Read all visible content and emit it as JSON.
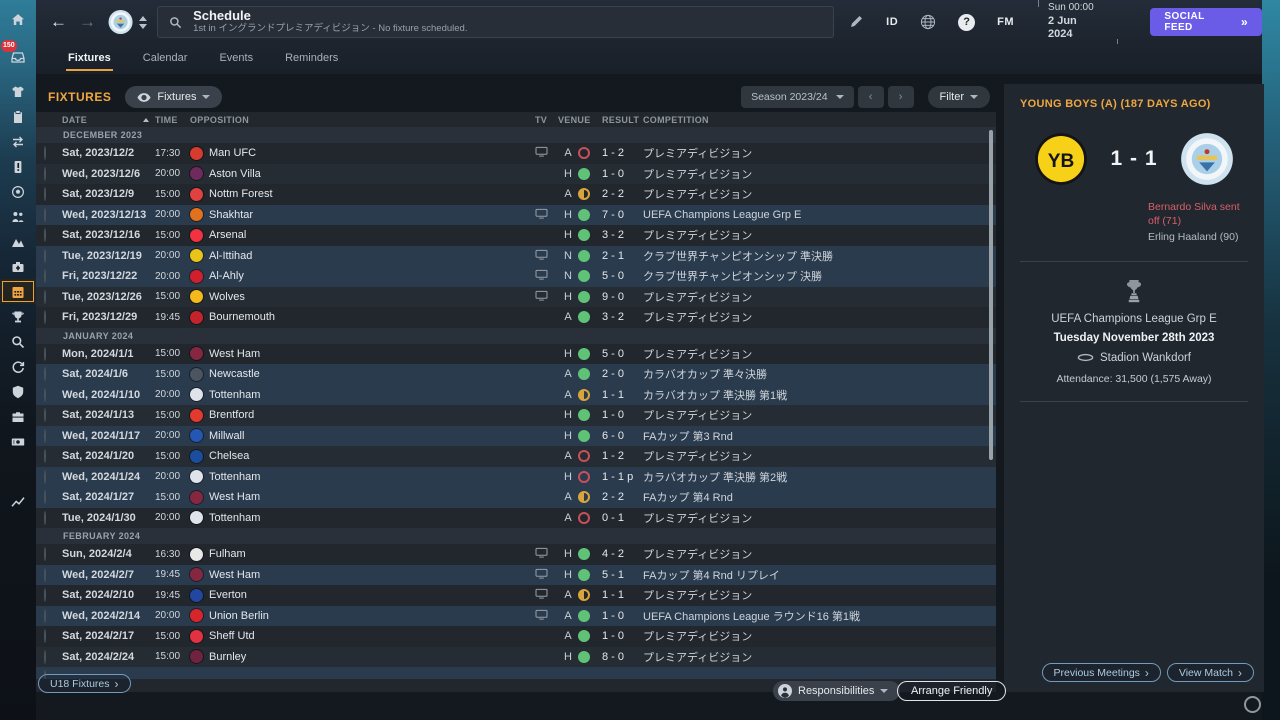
{
  "app": {
    "title": "Schedule",
    "subtitle": "1st in イングランドプレミアディビジョン - No fixture scheduled.",
    "id_label": "ID",
    "fm_label": "FM",
    "clock_time": "Sun 00:00",
    "clock_date": "2 Jun 2024",
    "social_feed": {
      "label": "SOCIAL FEED",
      "arrow": "»"
    }
  },
  "tabs": [
    {
      "label": "Fixtures",
      "active": true
    },
    {
      "label": "Calendar",
      "active": false
    },
    {
      "label": "Events",
      "active": false
    },
    {
      "label": "Reminders",
      "active": false
    }
  ],
  "sidebar": {
    "inbox_badge": "150",
    "items": [
      {
        "icon": "home"
      },
      {
        "icon": "inbox",
        "badge": "150"
      },
      {
        "icon": "shirt"
      },
      {
        "icon": "clipboard"
      },
      {
        "icon": "swap"
      },
      {
        "icon": "card"
      },
      {
        "icon": "ball"
      },
      {
        "icon": "staff"
      },
      {
        "icon": "mountain"
      },
      {
        "icon": "medical"
      },
      {
        "icon": "calendar",
        "active": true
      },
      {
        "icon": "trophy"
      },
      {
        "icon": "search"
      },
      {
        "icon": "refresh"
      },
      {
        "icon": "shield"
      },
      {
        "icon": "briefcase"
      },
      {
        "icon": "money"
      },
      {
        "icon": "chart"
      }
    ]
  },
  "fixtures_panel": {
    "heading": "FIXTURES",
    "view_dropdown": "Fixtures",
    "season_dropdown": "Season 2023/24",
    "prev_label": "‹",
    "next_label": "›",
    "filter_label": "Filter",
    "columns": [
      "DATE",
      "TIME",
      "OPPOSITION",
      "TV",
      "VENUE",
      "RESULT",
      "COMPETITION"
    ],
    "sections": [
      {
        "month": "DECEMBER 2023",
        "rows": [
          {
            "date": "Sat, 2023/12/2",
            "time": "17:30",
            "team": "Man UFC",
            "badge": "#d63b2f",
            "tv": true,
            "venue": "A",
            "result": "loss",
            "score": "1 - 2",
            "comp": "プレミアディビジョン",
            "hl": false
          },
          {
            "date": "Wed, 2023/12/6",
            "time": "20:00",
            "team": "Aston Villa",
            "badge": "#6e2a5a",
            "tv": false,
            "venue": "H",
            "result": "win",
            "score": "1 - 0",
            "comp": "プレミアディビジョン",
            "hl": false
          },
          {
            "date": "Sat, 2023/12/9",
            "time": "15:00",
            "team": "Nottm Forest",
            "badge": "#e0433f",
            "tv": false,
            "venue": "A",
            "result": "draw",
            "score": "2 - 2",
            "comp": "プレミアディビジョン",
            "hl": false
          },
          {
            "date": "Wed, 2023/12/13",
            "time": "20:00",
            "team": "Shakhtar",
            "badge": "#e2711d",
            "tv": true,
            "venue": "H",
            "result": "win",
            "score": "7 - 0",
            "comp": "UEFA Champions League Grp E",
            "hl": true
          },
          {
            "date": "Sat, 2023/12/16",
            "time": "15:00",
            "team": "Arsenal",
            "badge": "#ef3340",
            "tv": false,
            "venue": "H",
            "result": "win",
            "score": "3 - 2",
            "comp": "プレミアディビジョン",
            "hl": false
          },
          {
            "date": "Tue, 2023/12/19",
            "time": "20:00",
            "team": "Al-Ittihad",
            "badge": "#e8c419",
            "tv": true,
            "venue": "N",
            "result": "win",
            "score": "2 - 1",
            "comp": "クラブ世界チャンピオンシップ 準決勝",
            "hl": true
          },
          {
            "date": "Fri, 2023/12/22",
            "time": "20:00",
            "team": "Al-Ahly",
            "badge": "#d0202e",
            "tv": true,
            "venue": "N",
            "result": "win",
            "score": "5 - 0",
            "comp": "クラブ世界チャンピオンシップ 決勝",
            "hl": true
          },
          {
            "date": "Tue, 2023/12/26",
            "time": "15:00",
            "team": "Wolves",
            "badge": "#f6b91c",
            "tv": true,
            "venue": "H",
            "result": "win",
            "score": "9 - 0",
            "comp": "プレミアディビジョン",
            "hl": false
          },
          {
            "date": "Fri, 2023/12/29",
            "time": "19:45",
            "team": "Bournemouth",
            "badge": "#c3242c",
            "tv": false,
            "venue": "A",
            "result": "win",
            "score": "3 - 2",
            "comp": "プレミアディビジョン",
            "hl": false
          }
        ]
      },
      {
        "month": "JANUARY 2024",
        "rows": [
          {
            "date": "Mon, 2024/1/1",
            "time": "15:00",
            "team": "West Ham",
            "badge": "#862740",
            "tv": false,
            "venue": "H",
            "result": "win",
            "score": "5 - 0",
            "comp": "プレミアディビジョン",
            "hl": false
          },
          {
            "date": "Sat, 2024/1/6",
            "time": "15:00",
            "team": "Newcastle",
            "badge": "#4a5560",
            "tv": false,
            "venue": "A",
            "result": "win",
            "score": "2 - 0",
            "comp": "カラバオカップ 準々決勝",
            "hl": true
          },
          {
            "date": "Wed, 2024/1/10",
            "time": "20:00",
            "team": "Tottenham",
            "badge": "#dfe4ea",
            "tv": false,
            "venue": "A",
            "result": "draw",
            "score": "1 - 1",
            "comp": "カラバオカップ 準決勝 第1戦",
            "hl": true
          },
          {
            "date": "Sat, 2024/1/13",
            "time": "15:00",
            "team": "Brentford",
            "badge": "#e23a2e",
            "tv": false,
            "venue": "H",
            "result": "win",
            "score": "1 - 0",
            "comp": "プレミアディビジョン",
            "hl": false
          },
          {
            "date": "Wed, 2024/1/17",
            "time": "20:00",
            "team": "Millwall",
            "badge": "#2456b4",
            "tv": false,
            "venue": "H",
            "result": "win",
            "score": "6 - 0",
            "comp": "FAカップ 第3 Rnd",
            "hl": true
          },
          {
            "date": "Sat, 2024/1/20",
            "time": "15:00",
            "team": "Chelsea",
            "badge": "#1a4e9c",
            "tv": false,
            "venue": "A",
            "result": "loss",
            "score": "1 - 2",
            "comp": "プレミアディビジョン",
            "hl": false
          },
          {
            "date": "Wed, 2024/1/24",
            "time": "20:00",
            "team": "Tottenham",
            "badge": "#dfe4ea",
            "tv": false,
            "venue": "H",
            "result": "loss",
            "score": "1 - 1 p",
            "comp": "カラバオカップ 準決勝 第2戦",
            "hl": true
          },
          {
            "date": "Sat, 2024/1/27",
            "time": "15:00",
            "team": "West Ham",
            "badge": "#862740",
            "tv": false,
            "venue": "A",
            "result": "draw",
            "score": "2 - 2",
            "comp": "FAカップ 第4 Rnd",
            "hl": true
          },
          {
            "date": "Tue, 2024/1/30",
            "time": "20:00",
            "team": "Tottenham",
            "badge": "#dfe4ea",
            "tv": false,
            "venue": "A",
            "result": "loss",
            "score": "0 - 1",
            "comp": "プレミアディビジョン",
            "hl": false
          }
        ]
      },
      {
        "month": "FEBRUARY 2024",
        "rows": [
          {
            "date": "Sun, 2024/2/4",
            "time": "16:30",
            "team": "Fulham",
            "badge": "#e8e8e8",
            "tv": true,
            "venue": "H",
            "result": "win",
            "score": "4 - 2",
            "comp": "プレミアディビジョン",
            "hl": false
          },
          {
            "date": "Wed, 2024/2/7",
            "time": "19:45",
            "team": "West Ham",
            "badge": "#862740",
            "tv": true,
            "venue": "H",
            "result": "win",
            "score": "5 - 1",
            "comp": "FAカップ 第4 Rnd リプレイ",
            "hl": true
          },
          {
            "date": "Sat, 2024/2/10",
            "time": "19:45",
            "team": "Everton",
            "badge": "#2247a0",
            "tv": true,
            "venue": "A",
            "result": "draw",
            "score": "1 - 1",
            "comp": "プレミアディビジョン",
            "hl": false
          },
          {
            "date": "Wed, 2024/2/14",
            "time": "20:00",
            "team": "Union Berlin",
            "badge": "#d8252c",
            "tv": true,
            "venue": "A",
            "result": "win",
            "score": "1 - 0",
            "comp": "UEFA Champions League ラウンド16 第1戦",
            "hl": true
          },
          {
            "date": "Sat, 2024/2/17",
            "time": "15:00",
            "team": "Sheff Utd",
            "badge": "#e23241",
            "tv": false,
            "venue": "A",
            "result": "win",
            "score": "1 - 0",
            "comp": "プレミアディビジョン",
            "hl": false
          },
          {
            "date": "Sat, 2024/2/24",
            "time": "15:00",
            "team": "Burnley",
            "badge": "#70233f",
            "tv": false,
            "venue": "H",
            "result": "win",
            "score": "8 - 0",
            "comp": "プレミアディビジョン",
            "hl": false
          },
          {
            "date": "",
            "time": "",
            "team": "",
            "badge": "#3f9e4f",
            "tv": false,
            "venue": "",
            "result": "",
            "score": "",
            "comp": "",
            "hl": true,
            "partial": true
          }
        ]
      }
    ],
    "u18_button": "U18 Fixtures",
    "responsibilities_button": "Responsibilities",
    "arrange_friendly_button": "Arrange Friendly"
  },
  "match_panel": {
    "header": "YOUNG BOYS (A) (187 DAYS AGO)",
    "home_short": "YB",
    "score": "1 - 1",
    "events": [
      {
        "text": "Bernardo Silva sent off (71)",
        "type": "red"
      },
      {
        "text": "Erling Haaland (90)",
        "type": "normal"
      }
    ],
    "competition": "UEFA Champions League Grp E",
    "date": "Tuesday November 28th 2023",
    "stadium": "Stadion Wankdorf",
    "attendance": "Attendance: 31,500 (1,575 Away)",
    "prev_meetings_button": "Previous Meetings",
    "view_match_button": "View Match"
  },
  "colors": {
    "accent_orange": "#f0a741",
    "social_purple": "#6b5ce8",
    "win_green": "#5fc276",
    "draw_amber": "#d9a43c",
    "loss_red": "#c9505a",
    "highlight_row": "#2a3b4e",
    "home_yellow": "#f7d117",
    "away_sky": "#aacfe8"
  }
}
